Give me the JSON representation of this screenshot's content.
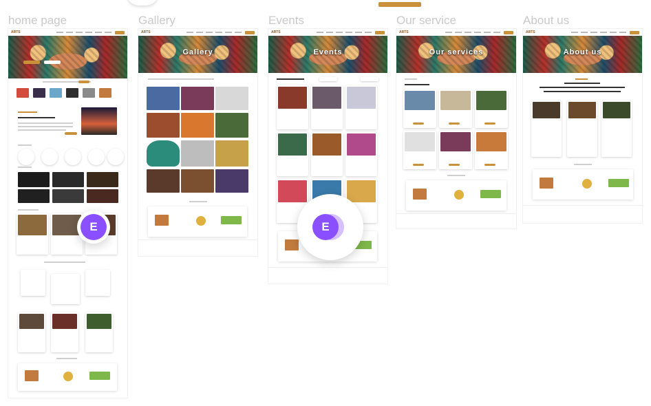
{
  "pages": [
    {
      "key": "home",
      "label": "home page",
      "hero_title": ""
    },
    {
      "key": "gallery",
      "label": "Gallery",
      "hero_title": "Gallery"
    },
    {
      "key": "events",
      "label": "Events",
      "hero_title": "Events"
    },
    {
      "key": "services",
      "label": "Our service",
      "hero_title": "Our services"
    },
    {
      "key": "about",
      "label": "About us",
      "hero_title": "About us"
    }
  ],
  "badge": {
    "letter": "E"
  },
  "colors": {
    "accent": "#c8913a",
    "badge": "#8a4fff",
    "label": "#c9c9c9"
  }
}
